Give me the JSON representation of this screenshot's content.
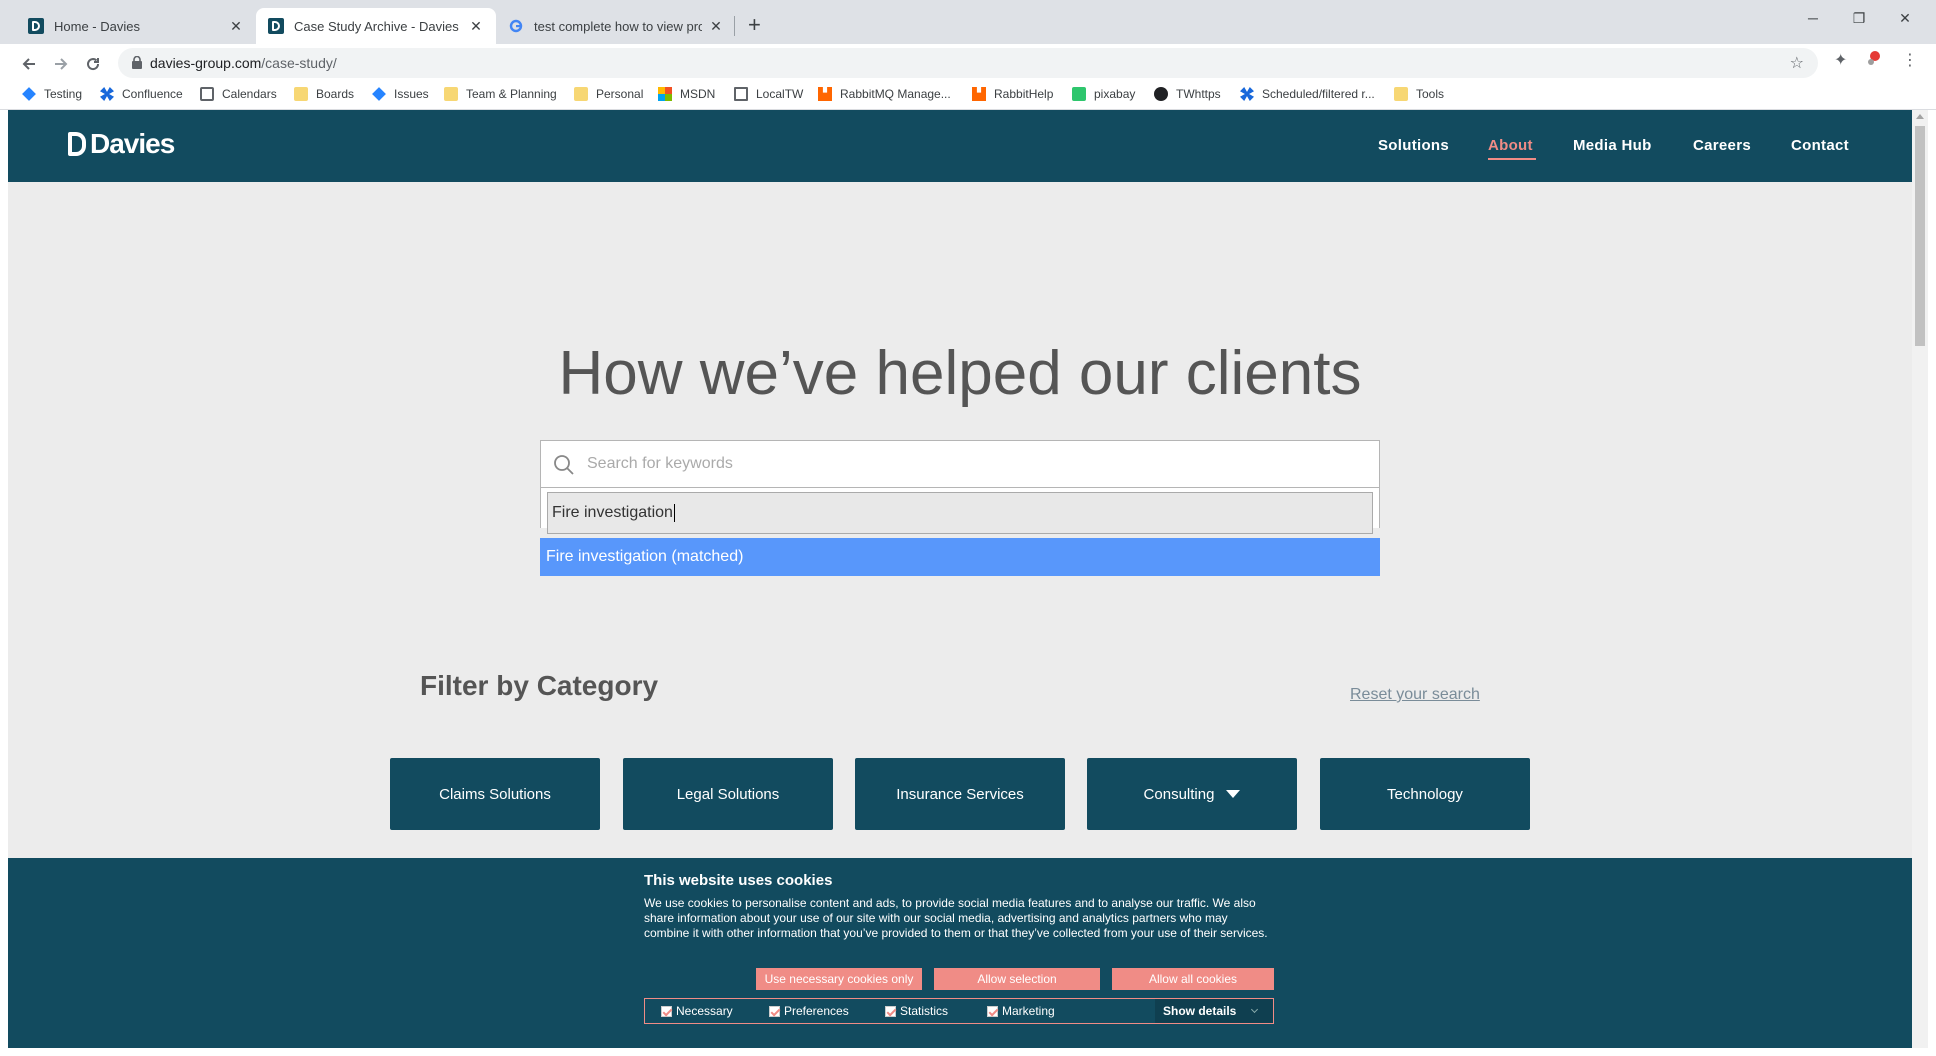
{
  "browser": {
    "tabs": [
      {
        "title": "Home - Davies"
      },
      {
        "title": "Case Study Archive - Davies"
      },
      {
        "title": "test complete how to view project"
      }
    ],
    "url_domain": "davies-group.com",
    "url_path": "/case-study/",
    "bookmarks": [
      {
        "label": "Testing",
        "icon": "jira-icon"
      },
      {
        "label": "Confluence",
        "icon": "confluence-icon"
      },
      {
        "label": "Calendars",
        "icon": "calendar-icon"
      },
      {
        "label": "Boards",
        "icon": "folder-icon"
      },
      {
        "label": "Issues",
        "icon": "jira-icon"
      },
      {
        "label": "Team & Planning",
        "icon": "folder-icon"
      },
      {
        "label": "Personal",
        "icon": "folder-icon"
      },
      {
        "label": "MSDN",
        "icon": "microsoft-icon"
      },
      {
        "label": "LocalTW",
        "icon": "local-icon"
      },
      {
        "label": "RabbitMQ Manage...",
        "icon": "rabbitmq-icon"
      },
      {
        "label": "RabbitHelp",
        "icon": "rabbitmq-icon"
      },
      {
        "label": "pixabay",
        "icon": "pixabay-icon"
      },
      {
        "label": "TWhttps",
        "icon": "tw-icon"
      },
      {
        "label": "Scheduled/filtered r...",
        "icon": "confluence-icon"
      },
      {
        "label": "Tools",
        "icon": "folder-icon"
      }
    ]
  },
  "site": {
    "logo": "Davies",
    "nav": [
      "Solutions",
      "About",
      "Media Hub",
      "Careers",
      "Contact"
    ],
    "active_nav": "About"
  },
  "hero": {
    "title": "How we’ve helped our clients"
  },
  "search": {
    "placeholder": "Search for keywords",
    "typed_value": "Fire investigation",
    "option": "Fire investigation (matched)"
  },
  "filter": {
    "title": "Filter by Category",
    "reset": "Reset your search",
    "categories": [
      "Claims Solutions",
      "Legal Solutions",
      "Insurance Services",
      "Consulting",
      "Technology"
    ]
  },
  "cookies": {
    "title": "This website uses cookies",
    "text": "We use cookies to personalise content and ads, to provide social media features and to analyse our traffic. We also share information about your use of our site with our social media, advertising and analytics partners who may combine it with other information that you’ve provided to them or that they’ve collected from your use of their services.",
    "buttons": [
      "Use necessary cookies only",
      "Allow selection",
      "Allow all cookies"
    ],
    "options": [
      "Necessary",
      "Preferences",
      "Statistics",
      "Marketing"
    ],
    "show_details": "Show details"
  },
  "colors": {
    "brand": "#124b5f",
    "accent": "#f08c86",
    "highlight": "#5897fb",
    "page_bg": "#ececec"
  }
}
